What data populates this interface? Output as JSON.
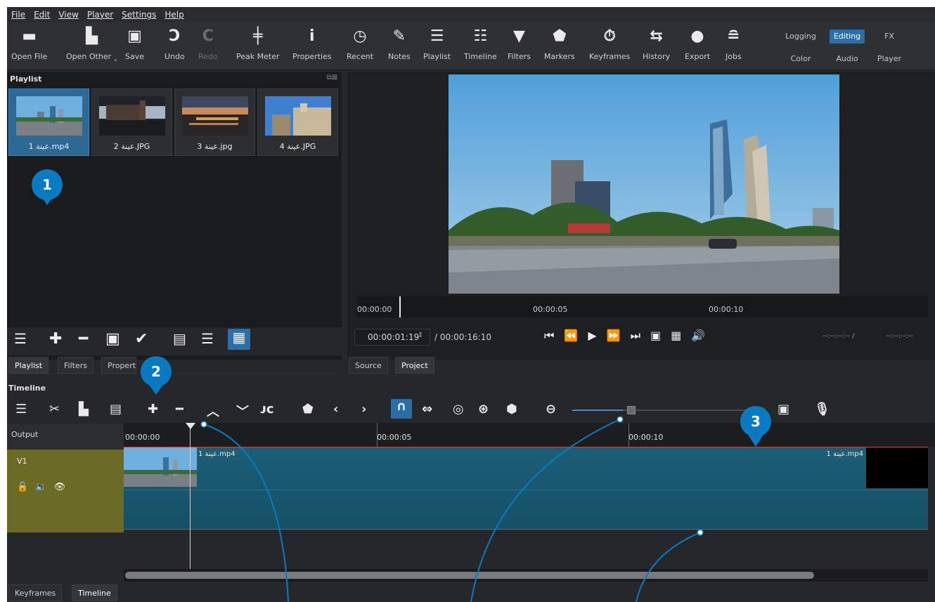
{
  "menu": [
    "File",
    "Edit",
    "View",
    "Player",
    "Settings",
    "Help"
  ],
  "toolbar": [
    {
      "label": "Open File",
      "icon": "folder-icon"
    },
    {
      "label": "Open Other",
      "icon": "open-other-icon"
    },
    {
      "label": "Save",
      "icon": "save-icon"
    },
    {
      "label": "Undo",
      "icon": "undo-icon"
    },
    {
      "label": "Redo",
      "icon": "redo-icon",
      "disabled": true
    },
    {
      "label": "Peak Meter",
      "icon": "peak-meter-icon"
    },
    {
      "label": "Properties",
      "icon": "info-icon"
    },
    {
      "label": "Recent",
      "icon": "clock-icon"
    },
    {
      "label": "Notes",
      "icon": "notes-icon"
    },
    {
      "label": "Playlist",
      "icon": "list-icon"
    },
    {
      "label": "Timeline",
      "icon": "timeline-icon"
    },
    {
      "label": "Filters",
      "icon": "filter-icon"
    },
    {
      "label": "Markers",
      "icon": "marker-icon"
    },
    {
      "label": "Keyframes",
      "icon": "stopwatch-icon"
    },
    {
      "label": "History",
      "icon": "history-icon"
    },
    {
      "label": "Export",
      "icon": "export-icon"
    },
    {
      "label": "Jobs",
      "icon": "jobs-icon"
    }
  ],
  "workspaces": {
    "top": [
      "Logging",
      "Editing",
      "FX"
    ],
    "bottom": [
      "Color",
      "Audio",
      "Player"
    ],
    "active": "Editing"
  },
  "playlist": {
    "title": "Playlist",
    "items": [
      "1 عينة.mp4",
      "2 عينة.JPG",
      "3 عينة.jpg",
      "4 عينة.JPG"
    ],
    "tabs": [
      "Playlist",
      "Filters",
      "Properties"
    ]
  },
  "viewer": {
    "ruler_marks": [
      "00:00:00",
      "00:00:05",
      "00:00:10"
    ],
    "current_time": "00:00:01:19",
    "total_time": "/ 00:00:16:10",
    "in_out": "--:--:--:-- /",
    "in_out2": "--:--:--:--",
    "tabs": [
      "Source",
      "Project"
    ]
  },
  "timeline": {
    "title": "Timeline",
    "output_label": "Output",
    "track": "V1",
    "ruler_marks": [
      "00:00:00",
      "00:00:05",
      "00:00:10"
    ],
    "clip_name": "عينة 1.mp4",
    "tabs": [
      "Keyframes",
      "Timeline"
    ]
  },
  "badges": [
    "1",
    "2",
    "3"
  ],
  "colors": {
    "accent": "#0a7ac2",
    "selected": "#2e6996",
    "clip": "#1b5f77",
    "track": "#6b6b26"
  }
}
